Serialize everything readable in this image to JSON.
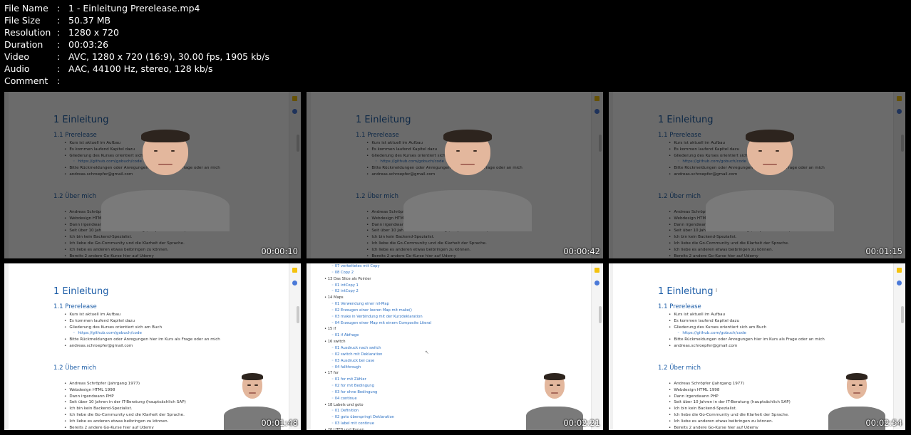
{
  "meta": [
    {
      "key": "File Name",
      "value": "1 - Einleitung Prerelease.mp4"
    },
    {
      "key": "File Size",
      "value": "50.37 MB"
    },
    {
      "key": "Resolution",
      "value": "1280 x 720"
    },
    {
      "key": "Duration",
      "value": "00:03:26"
    },
    {
      "key": "Video",
      "value": "AVC, 1280 x 720 (16:9), 30.00 fps, 1905 kb/s"
    },
    {
      "key": "Audio",
      "value": "AAC, 44100 Hz, stereo, 128 kb/s"
    },
    {
      "key": "Comment",
      "value": ""
    }
  ],
  "doc": {
    "title": "1 Einleitung",
    "section1": "1.1 Prerelease",
    "bullets1": [
      "Kurs ist aktuell im Aufbau",
      "Es kommen laufend Kapitel dazu",
      "Gliederung des Kurses orientiert sich am Buch"
    ],
    "link": "https://github.com/gobuch/code",
    "bullets1b": [
      "Bitte Rückmeldungen oder Anregungen hier im Kurs als Frage oder an mich",
      "andreas.schroepfer@gmail.com"
    ],
    "section2": "1.2 Über mich",
    "bullets2": [
      "Andreas Schröpfer (Jahrgang 1977)",
      "Webdesign HTML 1998",
      "Dann irgendwann PHP",
      "Seit über 10 Jahren in der IT-Beratung (hauptsächlich SAP)",
      "Ich bin kein Backend-Spezialist.",
      "Ich liebe die Go-Community und die Klarheit der Sprache.",
      "Ich liebe es anderen etwas beibringen zu können.",
      "Bereits 2 andere Go-Kurse hier auf Udemy"
    ]
  },
  "toc": [
    {
      "level": 2,
      "text": "07 verkettetes mit Copy"
    },
    {
      "level": 2,
      "text": "08 Copy 2"
    },
    {
      "level": 1,
      "text": "13 Das Slice als Pointer"
    },
    {
      "level": 2,
      "text": "01 intCopy 1"
    },
    {
      "level": 2,
      "text": "02 intCopy 2"
    },
    {
      "level": 1,
      "text": "14 Maps"
    },
    {
      "level": 2,
      "text": "01 Verwendung einer nil-Map"
    },
    {
      "level": 2,
      "text": "02 Erzeugen einer leeren Map mit make()"
    },
    {
      "level": 2,
      "text": "03 make in Verbindung mit der Kurzdeklaration"
    },
    {
      "level": 2,
      "text": "04 Erzeugen einer Map mit einem Composite Literal"
    },
    {
      "level": 1,
      "text": "15 if"
    },
    {
      "level": 2,
      "text": "01 if Abfrage"
    },
    {
      "level": 1,
      "text": "16 switch"
    },
    {
      "level": 2,
      "text": "01 Ausdruck nach switch"
    },
    {
      "level": 2,
      "text": "02 switch mit Deklaration"
    },
    {
      "level": 2,
      "text": "03 Ausdruck bei case"
    },
    {
      "level": 2,
      "text": "04 fallthrough"
    },
    {
      "level": 1,
      "text": "17 for"
    },
    {
      "level": 2,
      "text": "01 for mit Zähler"
    },
    {
      "level": 2,
      "text": "02 for mit Bedingung"
    },
    {
      "level": 2,
      "text": "03 for ohne Bedingung"
    },
    {
      "level": 2,
      "text": "04 continue"
    },
    {
      "level": 1,
      "text": "18 Labels und goto"
    },
    {
      "level": 2,
      "text": "01 Definition"
    },
    {
      "level": 2,
      "text": "02 goto überspringt Deklaration"
    },
    {
      "level": 2,
      "text": "03 label mit continue"
    },
    {
      "level": 1,
      "text": "20 UTF8 und Runen"
    }
  ],
  "timestamps": [
    "00:00:10",
    "00:00:42",
    "00:01:15",
    "00:01:48",
    "00:02:21",
    "00:02:54"
  ],
  "colors": {
    "heading": "#1f5fa8",
    "link": "#2a6fc2",
    "shirt": "#7a7a7a"
  }
}
